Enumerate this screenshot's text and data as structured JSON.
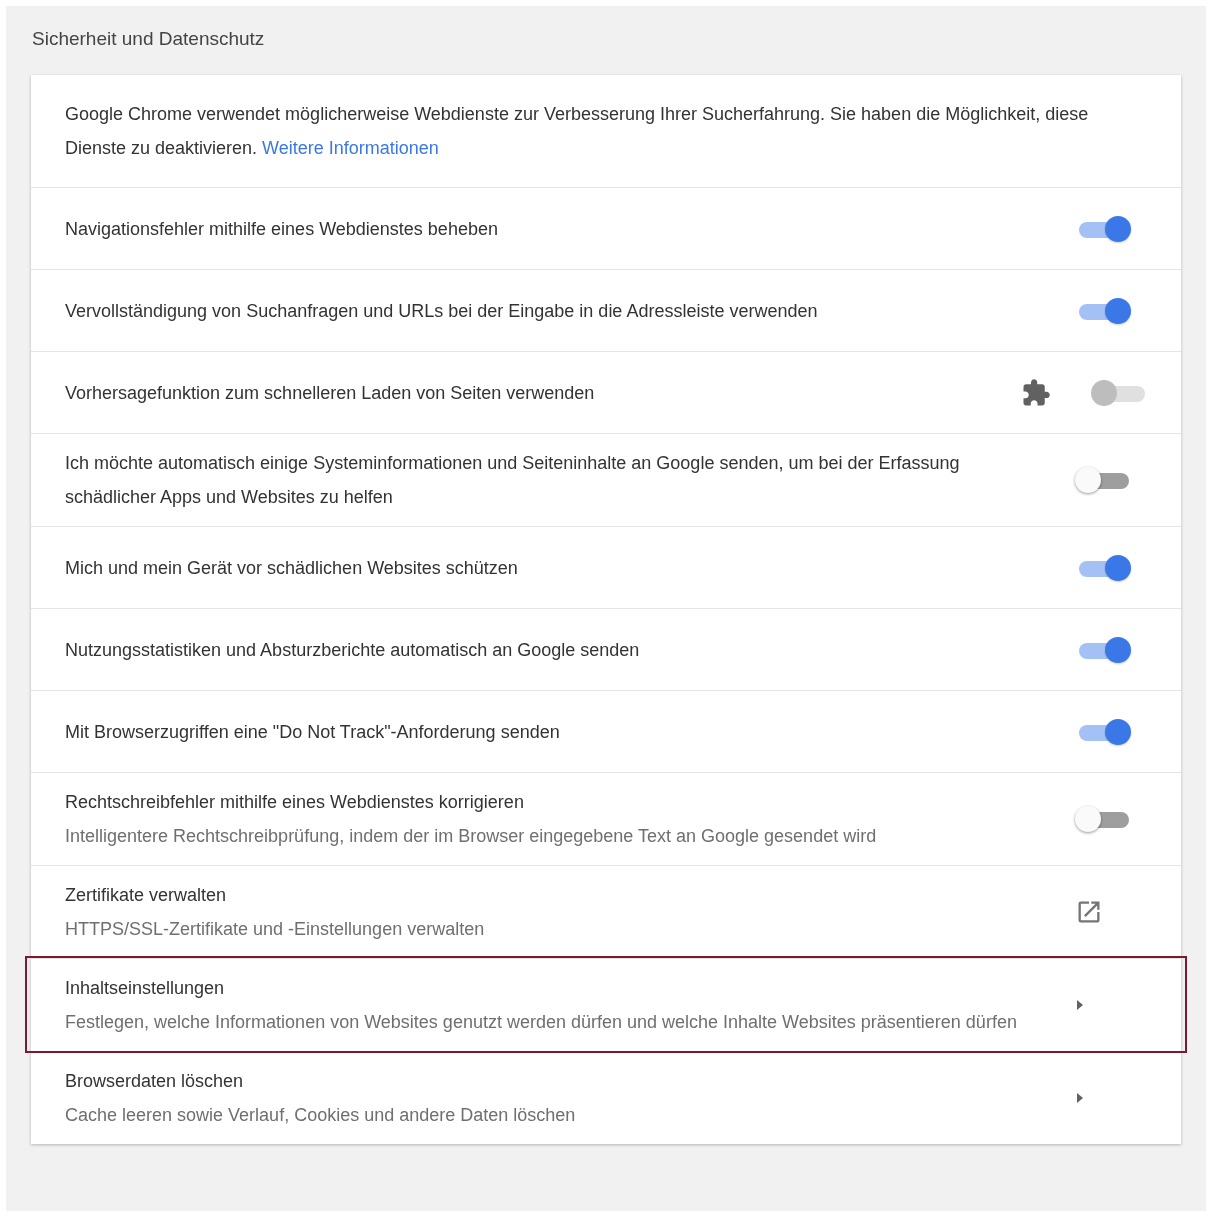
{
  "section": {
    "title": "Sicherheit und Datenschutz"
  },
  "intro": {
    "text": "Google Chrome verwendet möglicherweise Webdienste zur Verbesserung Ihrer Sucherfahrung. Sie haben die Möglichkeit, diese Dienste zu deaktivieren.",
    "link": "Weitere Informationen"
  },
  "rows": [
    {
      "kind": "toggle",
      "label": "Navigationsfehler mithilfe eines Webdienstes beheben",
      "on": true,
      "disabled": false,
      "highlighted": false
    },
    {
      "kind": "toggle",
      "label": "Vervollständigung von Suchanfragen und URLs bei der Eingabe in die Adressleiste verwenden",
      "on": true,
      "disabled": false,
      "highlighted": false
    },
    {
      "kind": "toggle",
      "label": "Vorhersagefunktion zum schnelleren Laden von Seiten verwenden",
      "on": false,
      "disabled": true,
      "highlighted": false
    },
    {
      "kind": "toggle",
      "label": "Ich möchte automatisch einige Systeminformationen und Seiteninhalte an Google senden, um bei der Erfassung schädlicher Apps und Websites zu helfen",
      "on": false,
      "disabled": false,
      "highlighted": false
    },
    {
      "kind": "toggle",
      "label": "Mich und mein Gerät vor schädlichen Websites schützen",
      "on": true,
      "disabled": false,
      "highlighted": false
    },
    {
      "kind": "toggle",
      "label": "Nutzungsstatistiken und Absturzberichte automatisch an Google senden",
      "on": true,
      "disabled": false,
      "highlighted": false
    },
    {
      "kind": "toggle",
      "label": "Mit Browserzugriffen eine \"Do Not Track\"-Anforderung senden",
      "on": true,
      "disabled": false,
      "highlighted": false
    },
    {
      "kind": "toggle",
      "label": "Rechtschreibfehler mithilfe eines Webdienstes korrigieren",
      "sublabel": "Intelligentere Rechtschreibprüfung, indem der im Browser eingegebene Text an Google gesendet wird",
      "on": false,
      "disabled": false,
      "highlighted": false
    },
    {
      "kind": "external",
      "label": "Zertifikate verwalten",
      "sublabel": "HTTPS/SSL-Zertifikate und -Einstellungen verwalten",
      "highlighted": false
    },
    {
      "kind": "subpage",
      "label": "Inhaltseinstellungen",
      "sublabel": "Festlegen, welche Informationen von Websites genutzt werden dürfen und welche Inhalte Websites präsentieren dürfen",
      "highlighted": true
    },
    {
      "kind": "subpage",
      "label": "Browserdaten löschen",
      "sublabel": "Cache leeren sowie Verlauf, Cookies und andere Daten löschen",
      "highlighted": false
    }
  ]
}
